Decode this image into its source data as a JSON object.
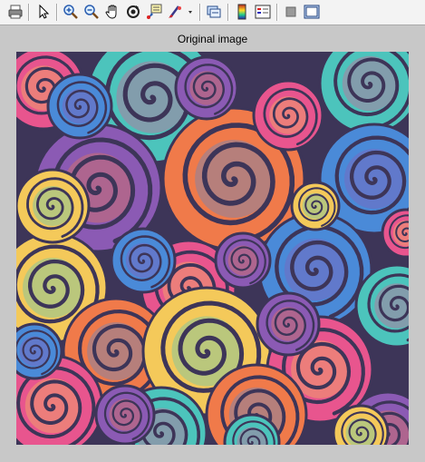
{
  "window": {
    "figure_title": "Original image"
  },
  "toolbar": {
    "buttons": [
      {
        "name": "print-button",
        "icon": "printer-icon"
      },
      {
        "name": "select-button",
        "icon": "arrow-cursor-icon"
      },
      {
        "name": "zoom-in-button",
        "icon": "zoom-in-icon"
      },
      {
        "name": "zoom-out-button",
        "icon": "zoom-out-icon"
      },
      {
        "name": "pan-button",
        "icon": "hand-icon"
      },
      {
        "name": "rotate-button",
        "icon": "rotate-3d-icon"
      },
      {
        "name": "data-cursor-button",
        "icon": "data-tip-icon"
      },
      {
        "name": "brush-button",
        "icon": "brush-icon"
      },
      {
        "name": "link-plot-button",
        "icon": "link-plot-icon"
      },
      {
        "name": "colorbar-button",
        "icon": "colorbar-icon"
      },
      {
        "name": "legend-button",
        "icon": "legend-icon"
      },
      {
        "name": "hide-plot-tools-button",
        "icon": "hide-tools-icon"
      },
      {
        "name": "show-plot-tools-button",
        "icon": "show-tools-icon"
      }
    ]
  },
  "colors": {
    "teal": "#4cc4bc",
    "purple": "#8b5ab4",
    "pink": "#e8558e",
    "orange": "#f07a4a",
    "yellow": "#f4c95a",
    "blue": "#4a8ad8",
    "dark": "#3d3558"
  }
}
